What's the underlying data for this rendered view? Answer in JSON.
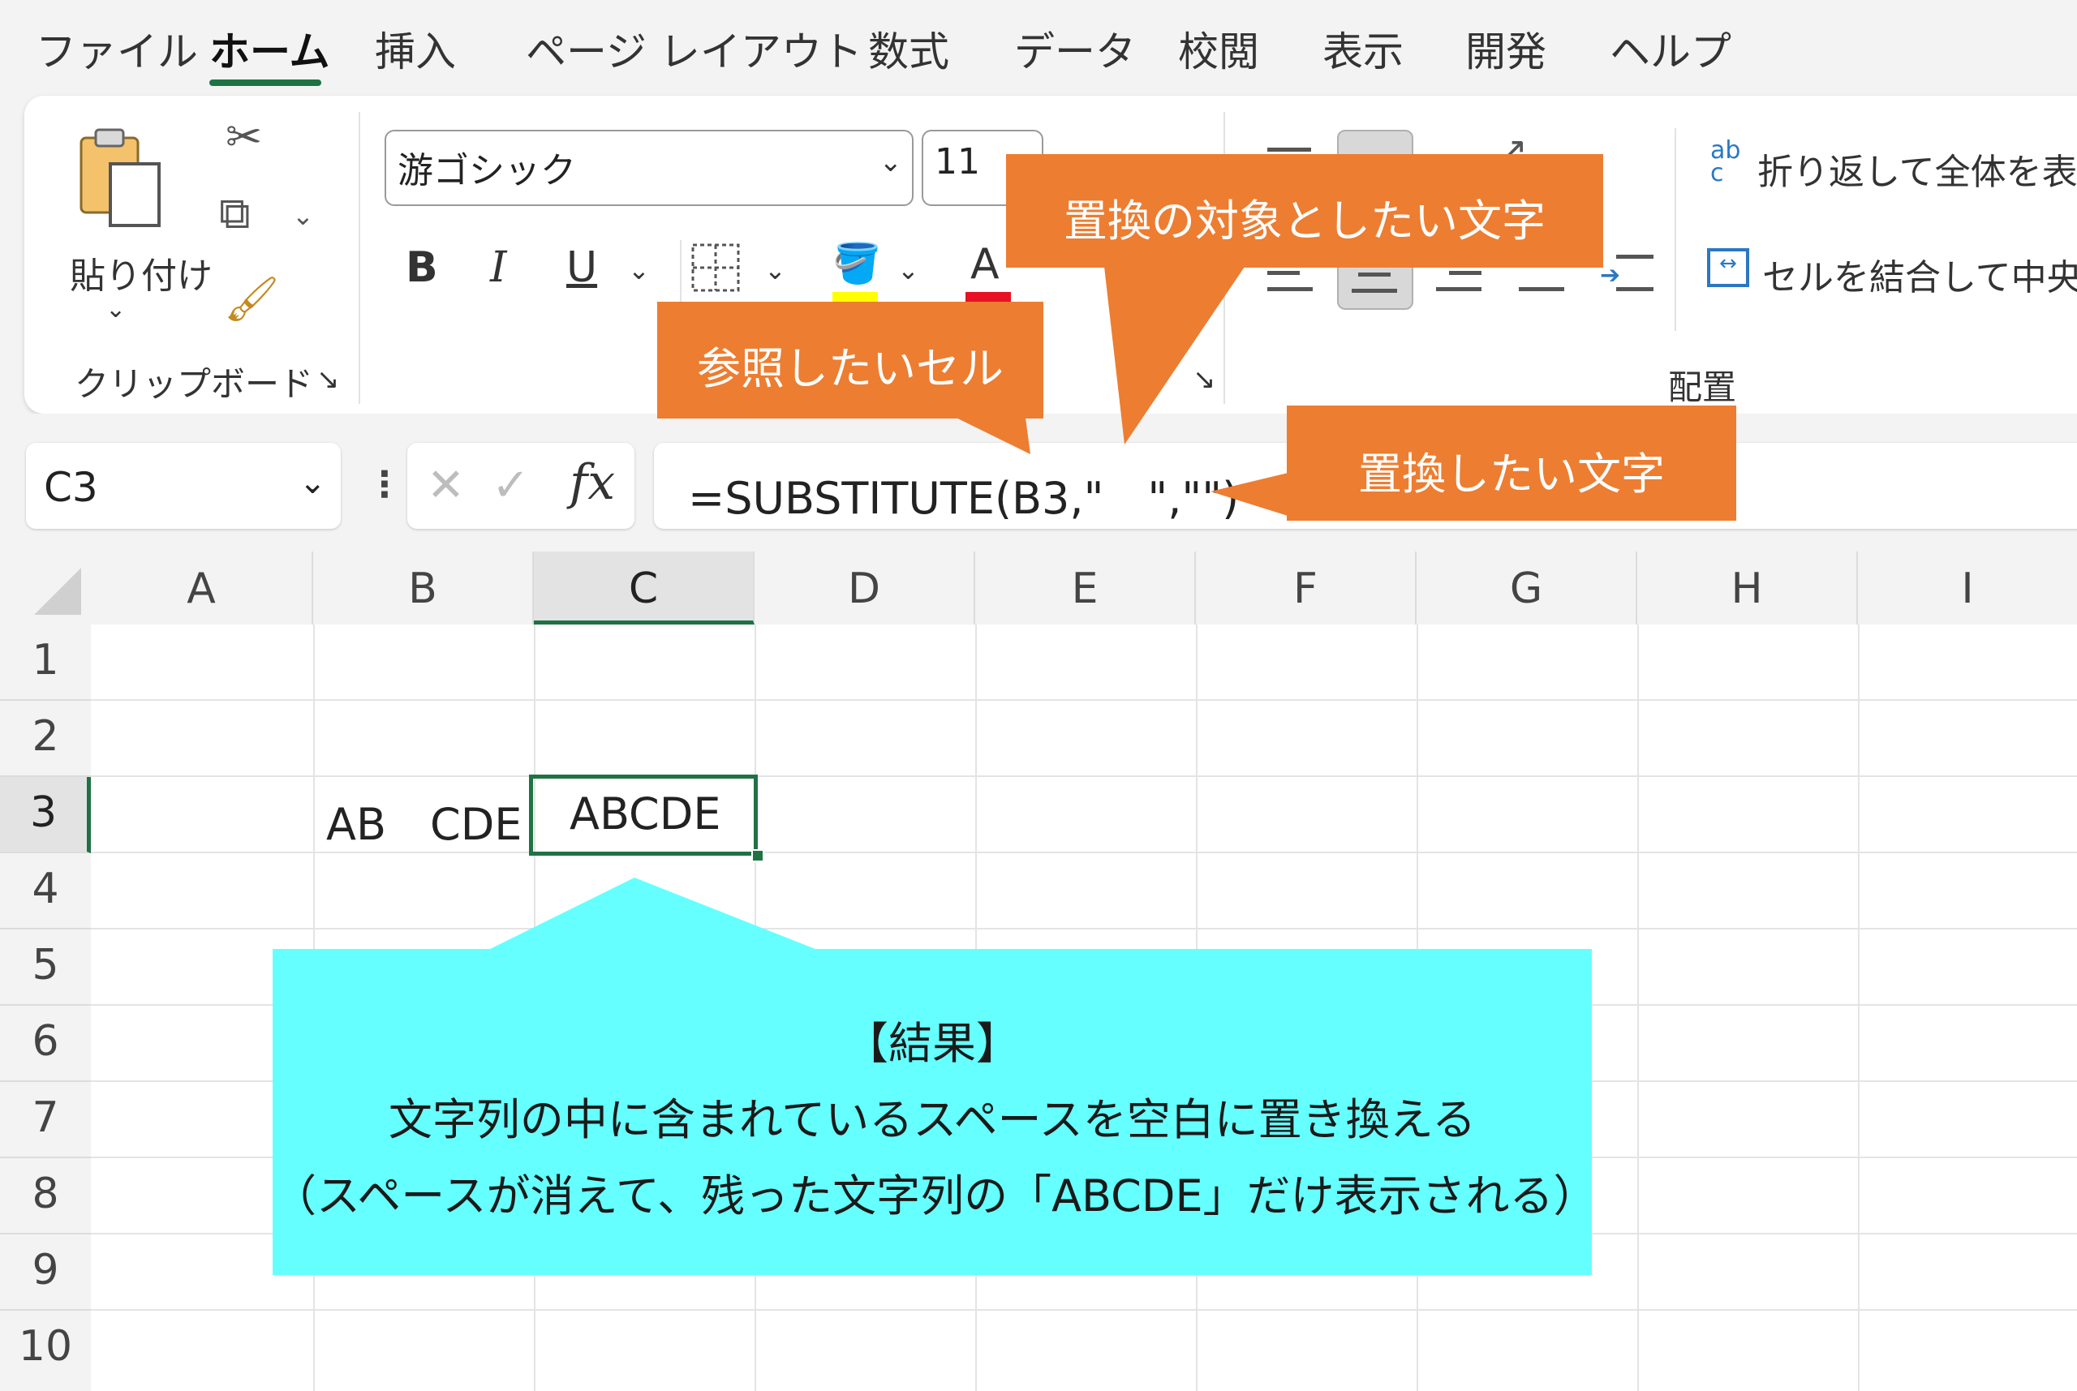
{
  "tabs": [
    "ファイル",
    "ホーム",
    "挿入",
    "ページ レイアウト",
    "数式",
    "データ",
    "校閲",
    "表示",
    "開発",
    "ヘルプ"
  ],
  "active_tab": "ホーム",
  "ribbon": {
    "paste_label": "貼り付け",
    "clipboard_group": "クリップボード",
    "font_name": "游ゴシック",
    "font_size": "11",
    "bold": "B",
    "italic": "I",
    "underline": "U",
    "font_color_glyph": "A",
    "alignment_group": "配置",
    "wrap_text": "折り返して全体を表示",
    "merge_center": "セルを結合して中央揃え",
    "wrap_icon_text": "ab c",
    "colors": {
      "font_color": "#e81123",
      "fill_color": "#ffff00",
      "accent": "#1f7244"
    }
  },
  "formula_bar": {
    "name_box": "C3",
    "cancel_glyph": "✕",
    "enter_glyph": "✓",
    "fx_glyph": "fx",
    "formula": "=SUBSTITUTE(B3,\"　\",\"\")"
  },
  "grid": {
    "columns": [
      "A",
      "B",
      "C",
      "D",
      "E",
      "F",
      "G",
      "H",
      "I"
    ],
    "rows": [
      "1",
      "2",
      "3",
      "4",
      "5",
      "6",
      "7",
      "8",
      "9",
      "10"
    ],
    "selected_column": "C",
    "selected_row": "3",
    "cells": {
      "B3": "AB　CDE",
      "C3": "ABCDE"
    }
  },
  "callouts": {
    "reference_cell": "参照したいセル",
    "target_char": "置換の対象としたい文字",
    "replacement_char": "置換したい文字",
    "result_lines": [
      "【結果】",
      "文字列の中に含まれているスペースを空白に置き換える",
      "（スペースが消えて、残った文字列の「ABCDE」だけ表示される）"
    ],
    "colors": {
      "orange": "#ed7d31",
      "cyan": "#66ffff"
    }
  }
}
